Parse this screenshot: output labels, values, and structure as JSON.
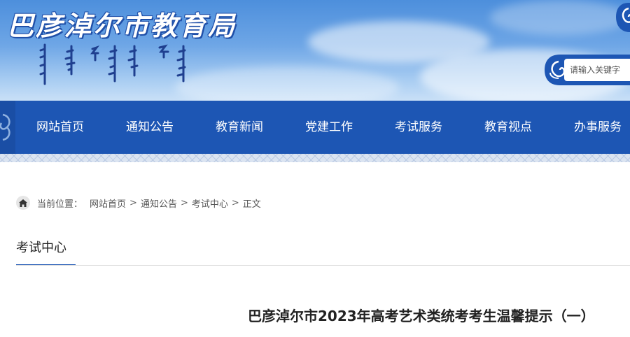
{
  "header": {
    "site_title": "巴彦淖尔市教育局",
    "search": {
      "placeholder": "请输入关键字",
      "value": ""
    }
  },
  "nav": {
    "items": [
      {
        "label": "网站首页"
      },
      {
        "label": "通知公告"
      },
      {
        "label": "教育新闻"
      },
      {
        "label": "党建工作"
      },
      {
        "label": "考试服务"
      },
      {
        "label": "教育视点"
      },
      {
        "label": "办事服务"
      }
    ]
  },
  "breadcrumb": {
    "label": "当前位置：",
    "items": [
      {
        "label": "网站首页"
      },
      {
        "label": "通知公告"
      },
      {
        "label": "考试中心"
      },
      {
        "label": "正文"
      }
    ],
    "separator": ">"
  },
  "section": {
    "title": "考试中心"
  },
  "article": {
    "title": "巴彦淖尔市2023年高考艺术类统考考生温馨提示（一）"
  },
  "colors": {
    "nav_background": "#1d56b4",
    "banner_sky": "#6ea6e6",
    "accent": "#1d56b4"
  },
  "icons": {
    "home": "home-icon",
    "search_frame": "mongolian-cloud-ornament"
  }
}
